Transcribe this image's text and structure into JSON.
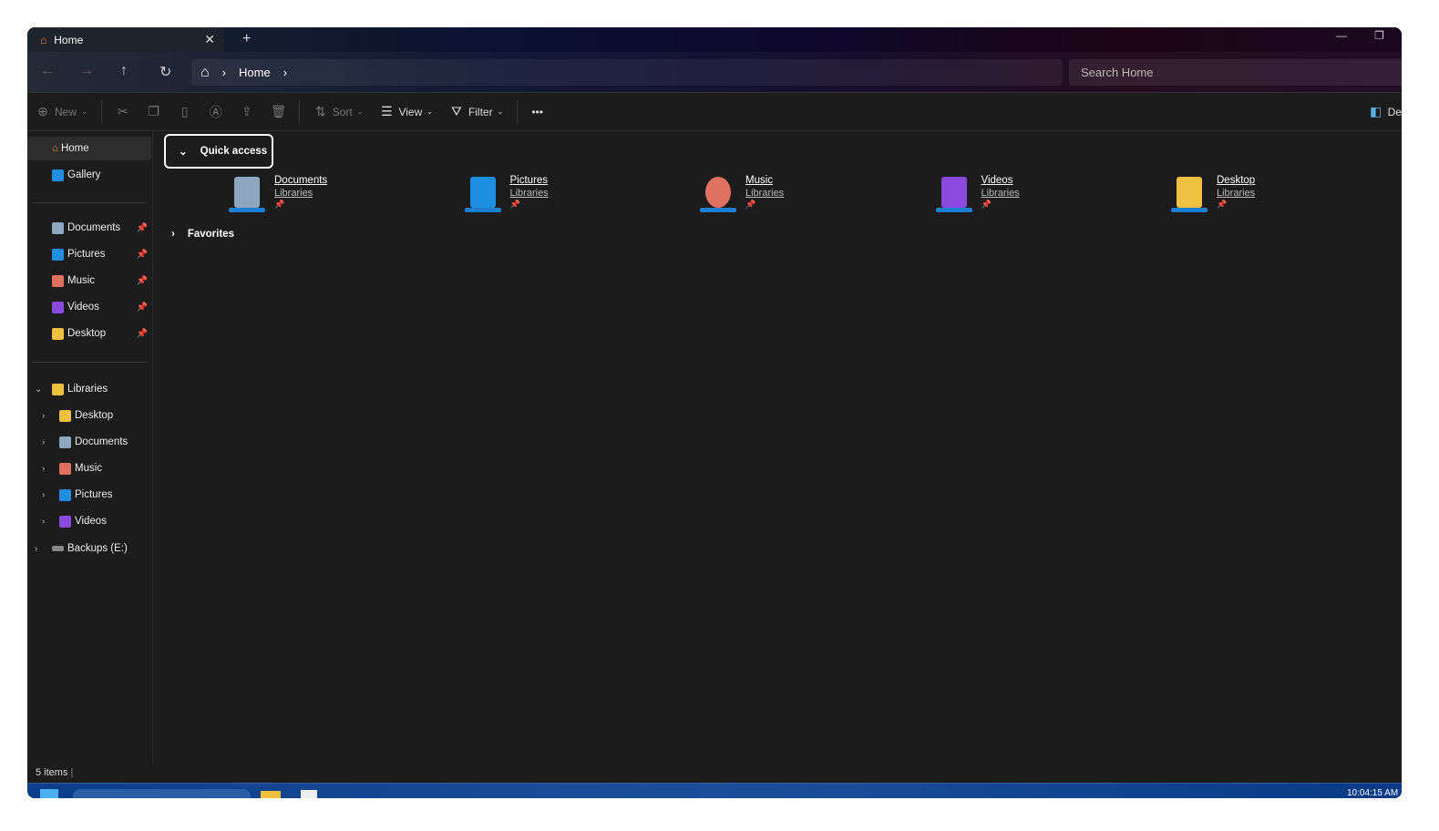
{
  "window": {
    "tab_title": "Home",
    "close": "✕",
    "new_tab": "+",
    "minimize": "—",
    "restore": "❐"
  },
  "nav": {
    "back": "←",
    "forward": "→",
    "up": "↑",
    "refresh": "↻",
    "home_icon": "⌂",
    "sep": "›",
    "crumb": "Home",
    "search_placeholder": "Search Home"
  },
  "toolbar": {
    "new": "New",
    "sort": "Sort",
    "view": "View",
    "filter": "Filter",
    "more": "•••",
    "details": "De"
  },
  "sidebar": {
    "top": [
      {
        "label": "Home",
        "icon": "home-icon"
      },
      {
        "label": "Gallery",
        "icon": "gallery-icon"
      }
    ],
    "pinned": [
      {
        "label": "Documents",
        "color": "#8fa6c0"
      },
      {
        "label": "Pictures",
        "color": "#1e8fe0"
      },
      {
        "label": "Music",
        "color": "#e07060"
      },
      {
        "label": "Videos",
        "color": "#8a4ae0"
      },
      {
        "label": "Desktop",
        "color": "#f0c040"
      }
    ],
    "libraries": {
      "label": "Libraries",
      "children": [
        {
          "label": "Desktop",
          "color": "#f0c040"
        },
        {
          "label": "Documents",
          "color": "#8fa6c0"
        },
        {
          "label": "Music",
          "color": "#e07060"
        },
        {
          "label": "Pictures",
          "color": "#1e8fe0"
        },
        {
          "label": "Videos",
          "color": "#8a4ae0"
        }
      ]
    },
    "drive": {
      "label": "Backups (E:)"
    }
  },
  "main": {
    "quick_access": "Quick access",
    "favorites": "Favorites",
    "items": [
      {
        "name": "Documents",
        "sub": "Libraries",
        "color": "#8fa6c0"
      },
      {
        "name": "Pictures",
        "sub": "Libraries",
        "color": "#1e8fe0"
      },
      {
        "name": "Music",
        "sub": "Libraries",
        "color": "#e07060"
      },
      {
        "name": "Videos",
        "sub": "Libraries",
        "color": "#8a4ae0"
      },
      {
        "name": "Desktop",
        "sub": "Libraries",
        "color": "#f0c040"
      }
    ],
    "pin": "📌"
  },
  "status": {
    "items": "5 items"
  },
  "taskbar": {
    "clock": "10:04:15 AM"
  }
}
